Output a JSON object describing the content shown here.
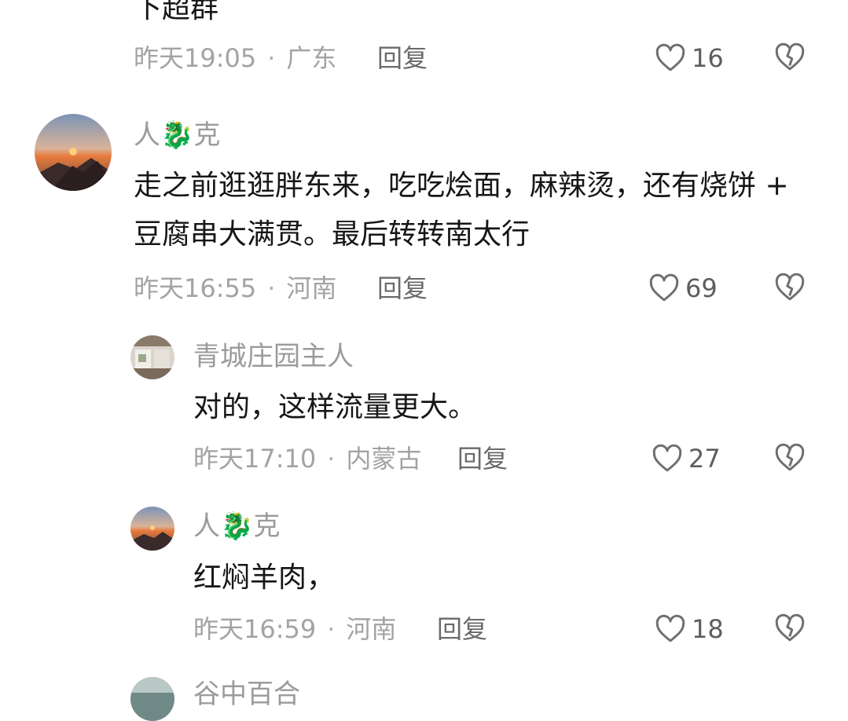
{
  "top_comment": {
    "text_fragment": "下超群",
    "time": "昨天19:05",
    "location": "广东",
    "reply_label": "回复",
    "likes": "16"
  },
  "comment1": {
    "username_left": "人",
    "username_mid": "🐉",
    "username_right": "克",
    "text": "走之前逛逛胖东来，吃吃烩面，麻辣烫，还有烧饼 + 豆腐串大满贯。最后转转南太行",
    "time": "昨天16:55",
    "location": "河南",
    "reply_label": "回复",
    "likes": "69"
  },
  "reply1": {
    "username": "青城庄园主人",
    "text": "对的，这样流量更大。",
    "time": "昨天17:10",
    "location": "内蒙古",
    "reply_label": "回复",
    "likes": "27"
  },
  "reply2": {
    "username_left": "人",
    "username_mid": "🐉",
    "username_right": "克",
    "text": "红焖羊肉，",
    "time": "昨天16:59",
    "location": "河南",
    "reply_label": "回复",
    "likes": "18"
  },
  "reply3": {
    "username_partial": "谷中百合"
  },
  "icons": {
    "like": "heart-outline-icon",
    "dislike": "broken-heart-icon"
  },
  "colors": {
    "meta_gray": "#a3a3a3",
    "username_gray": "#9b9b9b",
    "text": "#161616"
  }
}
